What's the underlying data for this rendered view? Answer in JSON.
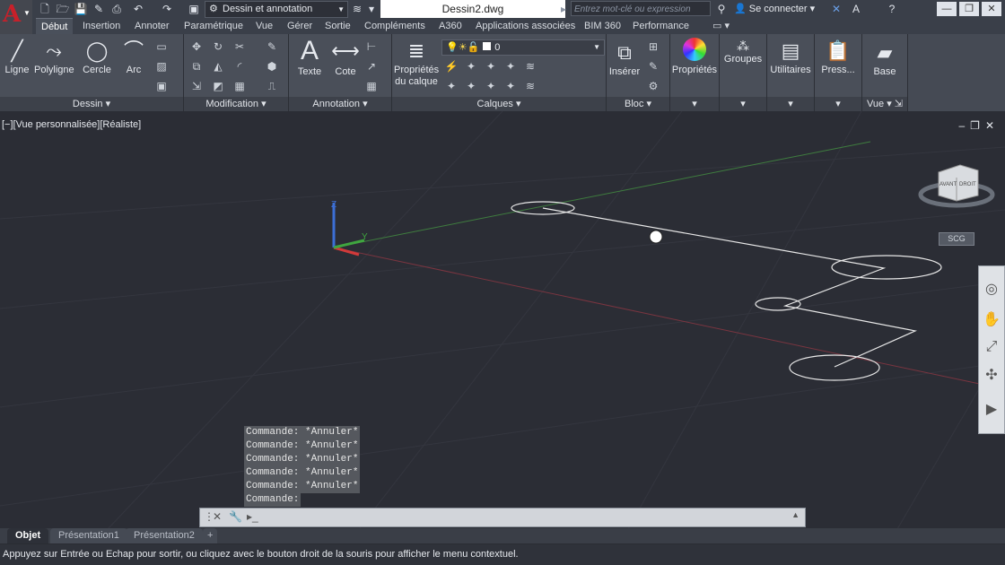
{
  "titlebar": {
    "workspace": "Dessin et annotation",
    "document_title": "Dessin2.dwg",
    "search_placeholder": "Entrez mot-clé ou expression",
    "login": "Se connecter"
  },
  "tabs": [
    "Début",
    "Insertion",
    "Annoter",
    "Paramétrique",
    "Vue",
    "Gérer",
    "Sortie",
    "Compléments",
    "A360",
    "Applications associées",
    "BIM 360",
    "Performance"
  ],
  "ribbon": {
    "dessin": {
      "ligne": "Ligne",
      "polyligne": "Polyligne",
      "cercle": "Cercle",
      "arc": "Arc",
      "title": "Dessin"
    },
    "modification": {
      "title": "Modification"
    },
    "annotation": {
      "texte": "Texte",
      "cote": "Cote",
      "title": "Annotation"
    },
    "calques": {
      "proprietes_l1": "Propriétés",
      "proprietes_l2": "du calque",
      "current_layer": "0",
      "title": "Calques"
    },
    "bloc": {
      "inserer": "Insérer",
      "title": "Bloc"
    },
    "proprietes": {
      "label": "Propriétés"
    },
    "groupes": {
      "label": "Groupes"
    },
    "utilitaires": {
      "label": "Utilitaires"
    },
    "presse": {
      "label": "Press..."
    },
    "vue": {
      "base": "Base",
      "title": "Vue"
    }
  },
  "viewport": {
    "label": "[−][Vue personnalisée][Réaliste]",
    "viewcube_front": "AVANT",
    "viewcube_right": "DROIT",
    "ucs_button": "SCG",
    "axis_z": "Z",
    "axis_y": "Y"
  },
  "command_history": [
    "Commande: *Annuler*",
    "Commande: *Annuler*",
    "Commande: *Annuler*",
    "Commande: *Annuler*",
    "Commande: *Annuler*",
    "Commande:"
  ],
  "layout_tabs": [
    "Objet",
    "Présentation1",
    "Présentation2"
  ],
  "status_text": "Appuyez sur Entrée ou Echap pour sortir, ou cliquez avec le bouton droit de la souris pour afficher le menu contextuel."
}
